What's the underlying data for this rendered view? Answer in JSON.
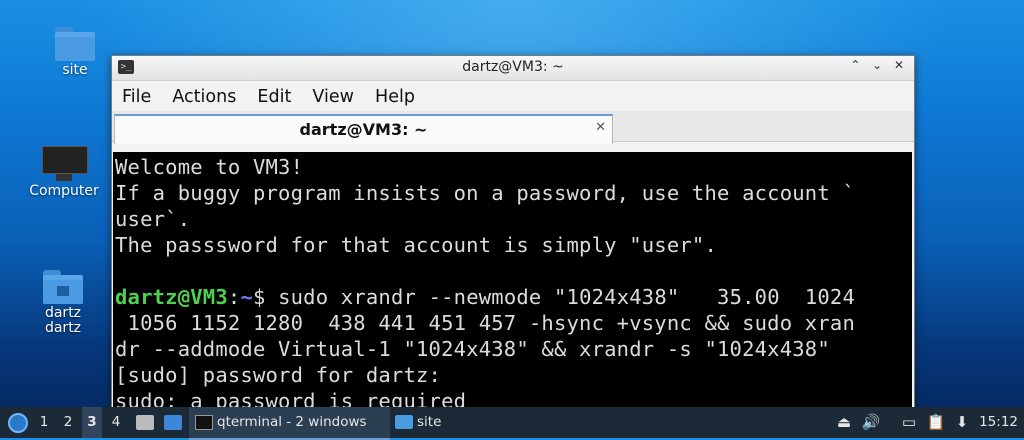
{
  "desktop": {
    "icons": [
      {
        "label": "site",
        "icon": "folder-icon"
      },
      {
        "label": "Computer",
        "icon": "computer-icon"
      },
      {
        "label": "dartz\ndartz",
        "icon": "home-folder-icon"
      }
    ]
  },
  "window": {
    "title": "dartz@VM3: ~",
    "menu": [
      "File",
      "Actions",
      "Edit",
      "View",
      "Help"
    ],
    "tab_title": "dartz@VM3: ~",
    "tab_close": "✕",
    "controls": {
      "minimize": "⌃",
      "restore": "⌄",
      "close": "✕"
    }
  },
  "terminal": {
    "lines": [
      "Welcome to VM3!",
      "If a buggy program insists on a password, use the account `",
      "user`.",
      "The passsword for that account is simply \"user\".",
      ""
    ],
    "prompt_user": "dartz@VM3",
    "prompt_sep": ":",
    "prompt_path": "~",
    "prompt_symbol": "$",
    "command_lines": [
      " sudo xrandr --newmode \"1024x438\"   35.00  1024",
      " 1056 1152 1280  438 441 451 457 -hsync +vsync && sudo xran",
      "dr --addmode Virtual-1 \"1024x438\" && xrandr -s \"1024x438\""
    ],
    "output_lines": [
      "[sudo] password for dartz:",
      "sudo: a password is required"
    ]
  },
  "taskbar": {
    "workspaces": [
      "1",
      "2",
      "3",
      "4"
    ],
    "active_workspace": "3",
    "tasks": [
      {
        "label": "qterminal - 2 windows",
        "icon": "terminal-icon",
        "active": true
      },
      {
        "label": "site",
        "icon": "folder-icon",
        "active": false
      }
    ],
    "clock": "15:12",
    "colors": {
      "panel": "#1c2a38",
      "accent": "#6a9fd6"
    }
  }
}
